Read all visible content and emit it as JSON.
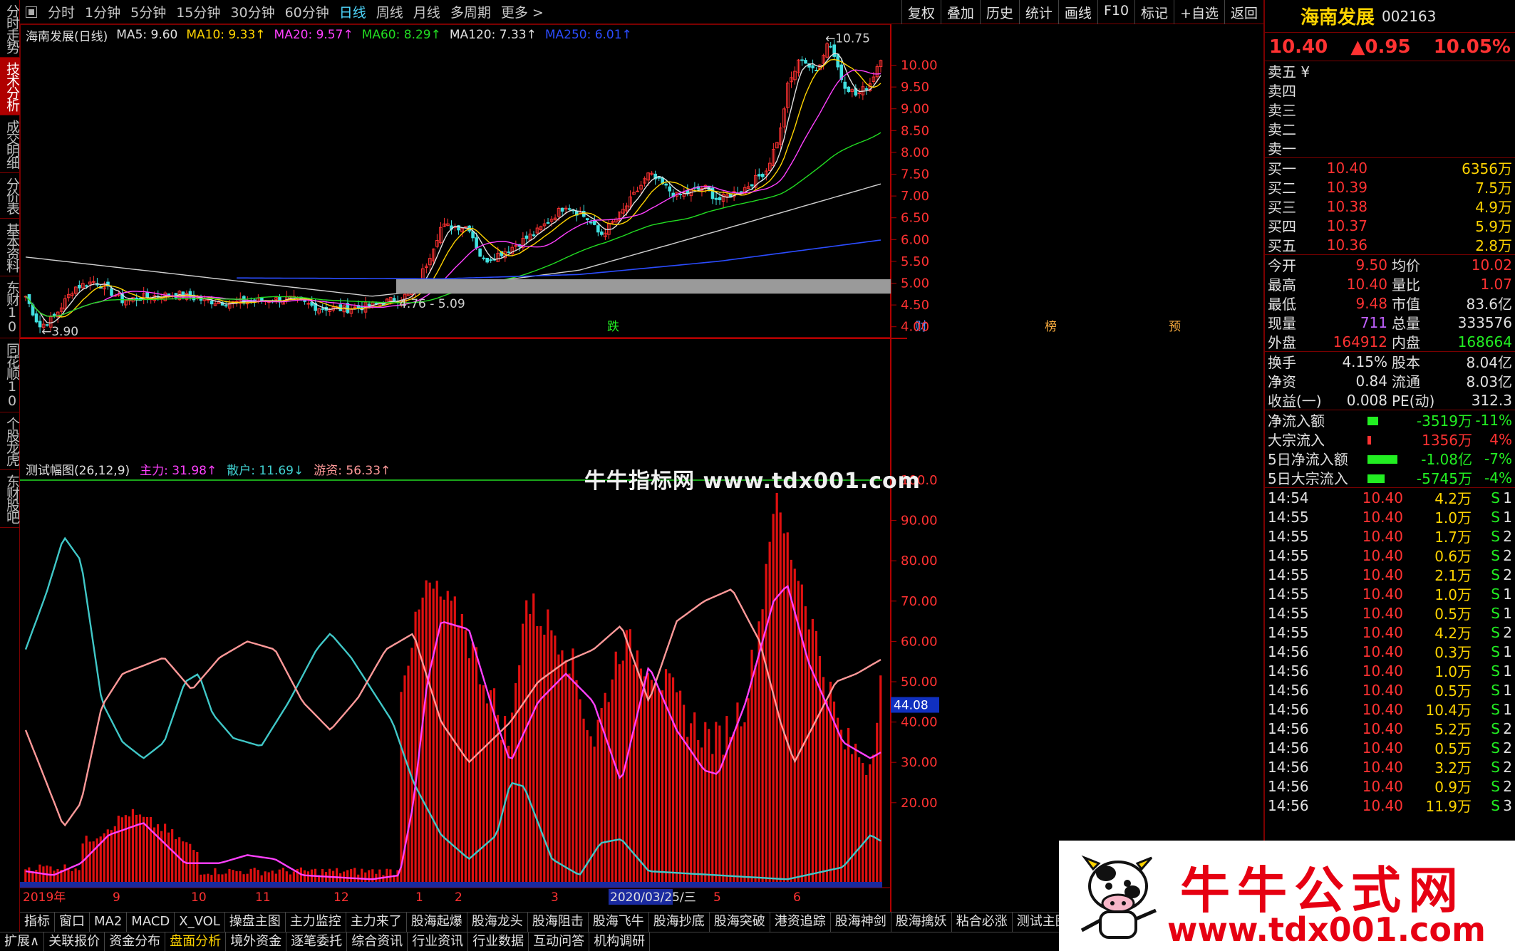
{
  "left_tabs": [
    {
      "label": "分时走势"
    },
    {
      "label": "技术分析",
      "active": true
    },
    {
      "label": "成交明细"
    },
    {
      "label": "分价表"
    },
    {
      "label": "基本资料"
    },
    {
      "label": "东财10"
    },
    {
      "label": "同花顺10"
    },
    {
      "label": "个股龙虎"
    },
    {
      "label": "东财股吧"
    }
  ],
  "toolbar": {
    "periods": [
      "分时",
      "1分钟",
      "5分钟",
      "15分钟",
      "30分钟",
      "60分钟",
      "日线",
      "周线",
      "月线",
      "多周期",
      "更多 >"
    ],
    "active_period": "日线",
    "buttons": [
      "复权",
      "叠加",
      "历史",
      "统计",
      "画线",
      "F10",
      "标记",
      "+自选",
      "返回"
    ]
  },
  "ma_legend": {
    "title": "海南发展(日线)",
    "items": [
      {
        "label": "MA5: 9.60",
        "color": "#e0e0e0"
      },
      {
        "label": "MA10: 9.33↑",
        "color": "#ffd400"
      },
      {
        "label": "MA20: 9.57↑",
        "color": "#ff40ff"
      },
      {
        "label": "MA60: 8.29↑",
        "color": "#22dd22"
      },
      {
        "label": "MA120: 7.33↑",
        "color": "#e0e0e0"
      },
      {
        "label": "MA250: 6.01↑",
        "color": "#2b4cff"
      }
    ]
  },
  "indicator_legend": {
    "title": "测试幅图(26,12,9)",
    "items": [
      {
        "label": "主力: 31.98↑",
        "color": "#ff40ff"
      },
      {
        "label": "散户: 11.69↓",
        "color": "#40d0d0"
      },
      {
        "label": "游资: 56.33↑",
        "color": "#ff9999"
      }
    ]
  },
  "price_axis": [
    "10.00",
    "9.50",
    "9.00",
    "8.50",
    "8.00",
    "7.50",
    "7.00",
    "6.50",
    "6.00",
    "5.50",
    "5.00",
    "4.50",
    "4.00"
  ],
  "indicator_axis": [
    "100.0",
    "90.00",
    "80.00",
    "70.00",
    "60.00",
    "50.00",
    "40.00",
    "30.00",
    "20.00"
  ],
  "indicator_current": "44.08",
  "annotations": {
    "high": "10.75",
    "low": "3.90",
    "range": "4.76 - 5.09"
  },
  "event_marks": [
    {
      "label": "跌",
      "color": "#22ee22"
    },
    {
      "label": "财",
      "color": "#4f8fff"
    },
    {
      "label": "榜",
      "color": "#ffb040"
    },
    {
      "label": "预",
      "color": "#ffb040"
    }
  ],
  "date_axis": [
    "2019年",
    "9",
    "10",
    "11",
    "12",
    "1",
    "2",
    "3",
    "2020/03/25/三",
    "5",
    "6"
  ],
  "bottom_tabs1": [
    "指标",
    "窗口",
    "MA2",
    "MACD",
    "X_VOL",
    "操盘主图",
    "主力监控",
    "主力来了",
    "股海起爆",
    "股海龙头",
    "股海阻击",
    "股海飞牛",
    "股海抄底",
    "股海突破",
    "港资追踪",
    "股海神剑",
    "股海擒妖",
    "粘合必涨",
    "测试主图"
  ],
  "bottom_tabs2": [
    "扩展∧",
    "关联报价",
    "资金分布",
    "盘面分析",
    "境外资金",
    "逐笔委托",
    "综合资讯",
    "行业资讯",
    "行业数据",
    "互动问答",
    "机构调研"
  ],
  "bottom_tabs2_active": "盘面分析",
  "quote": {
    "name": "海南发展",
    "code": "002163",
    "price": "10.40",
    "change": "▲0.95",
    "pct": "10.05%",
    "sell": [
      {
        "label": "卖五 ¥"
      },
      {
        "label": "卖四"
      },
      {
        "label": "卖三"
      },
      {
        "label": "卖二"
      },
      {
        "label": "卖一"
      }
    ],
    "buy": [
      {
        "label": "买一",
        "price": "10.40",
        "vol": "6356万"
      },
      {
        "label": "买二",
        "price": "10.39",
        "vol": "7.5万"
      },
      {
        "label": "买三",
        "price": "10.38",
        "vol": "4.9万"
      },
      {
        "label": "买四",
        "price": "10.37",
        "vol": "5.9万"
      },
      {
        "label": "买五",
        "price": "10.36",
        "vol": "2.8万"
      }
    ],
    "stats1": [
      {
        "k1": "今开",
        "v1": "9.50",
        "c1": "red",
        "k2": "均价",
        "v2": "10.02",
        "c2": "red"
      },
      {
        "k1": "最高",
        "v1": "10.40",
        "c1": "red",
        "k2": "量比",
        "v2": "1.07",
        "c2": "red"
      },
      {
        "k1": "最低",
        "v1": "9.48",
        "c1": "red",
        "k2": "市值",
        "v2": "83.6亿",
        "c2": "white"
      },
      {
        "k1": "现量",
        "v1": "711",
        "c1": "purple",
        "k2": "总量",
        "v2": "333576",
        "c2": "white"
      },
      {
        "k1": "外盘",
        "v1": "164912",
        "c1": "red",
        "k2": "内盘",
        "v2": "168664",
        "c2": "green"
      }
    ],
    "stats2": [
      {
        "k1": "换手",
        "v1": "4.15%",
        "k2": "股本",
        "v2": "8.04亿"
      },
      {
        "k1": "净资",
        "v1": "0.84",
        "k2": "流通",
        "v2": "8.03亿"
      },
      {
        "k1": "收益(一)",
        "v1": "0.008",
        "k2": "PE(动)",
        "v2": "312.3"
      }
    ],
    "flows": [
      {
        "label": "净流入额",
        "bar": 0.25,
        "bar_color": "#22ee22",
        "value": "-3519万",
        "pct": "-11%",
        "color": "green"
      },
      {
        "label": "大宗流入",
        "bar": 0.08,
        "bar_color": "#ff3232",
        "value": "1356万",
        "pct": "4%",
        "color": "red"
      },
      {
        "label": "5日净流入额",
        "bar": 0.7,
        "bar_color": "#22ee22",
        "value": "-1.08亿",
        "pct": "-7%",
        "color": "green"
      },
      {
        "label": "5日大宗流入",
        "bar": 0.4,
        "bar_color": "#22ee22",
        "value": "-5745万",
        "pct": "-4%",
        "color": "green"
      }
    ],
    "ticks": [
      {
        "time": "14:54",
        "price": "10.40",
        "vol": "4.2万",
        "side": "S",
        "n": "1"
      },
      {
        "time": "14:55",
        "price": "10.40",
        "vol": "1.0万",
        "side": "S",
        "n": "1"
      },
      {
        "time": "14:55",
        "price": "10.40",
        "vol": "1.7万",
        "side": "S",
        "n": "2"
      },
      {
        "time": "14:55",
        "price": "10.40",
        "vol": "0.6万",
        "side": "S",
        "n": "2"
      },
      {
        "time": "14:55",
        "price": "10.40",
        "vol": "2.1万",
        "side": "S",
        "n": "2"
      },
      {
        "time": "14:55",
        "price": "10.40",
        "vol": "1.0万",
        "side": "S",
        "n": "1"
      },
      {
        "time": "14:55",
        "price": "10.40",
        "vol": "0.5万",
        "side": "S",
        "n": "1"
      },
      {
        "time": "14:55",
        "price": "10.40",
        "vol": "4.2万",
        "side": "S",
        "n": "2"
      },
      {
        "time": "14:56",
        "price": "10.40",
        "vol": "0.3万",
        "side": "S",
        "n": "1"
      },
      {
        "time": "14:56",
        "price": "10.40",
        "vol": "1.0万",
        "side": "S",
        "n": "1"
      },
      {
        "time": "14:56",
        "price": "10.40",
        "vol": "0.5万",
        "side": "S",
        "n": "1"
      },
      {
        "time": "14:56",
        "price": "10.40",
        "vol": "10.4万",
        "side": "S",
        "n": "1"
      },
      {
        "time": "14:56",
        "price": "10.40",
        "vol": "5.2万",
        "side": "S",
        "n": "2"
      },
      {
        "time": "14:56",
        "price": "10.40",
        "vol": "0.5万",
        "side": "S",
        "n": "2"
      },
      {
        "time": "14:56",
        "price": "10.40",
        "vol": "3.2万",
        "side": "S",
        "n": "2"
      },
      {
        "time": "14:56",
        "price": "10.40",
        "vol": "0.9万",
        "side": "S",
        "n": "2"
      },
      {
        "time": "14:56",
        "price": "10.40",
        "vol": "11.9万",
        "side": "S",
        "n": "3"
      }
    ]
  },
  "watermarks": {
    "mid": "牛牛指标网 www.tdx001.com",
    "logo_line1": "牛牛公式网",
    "logo_line2": "www.tdx001.com"
  }
}
